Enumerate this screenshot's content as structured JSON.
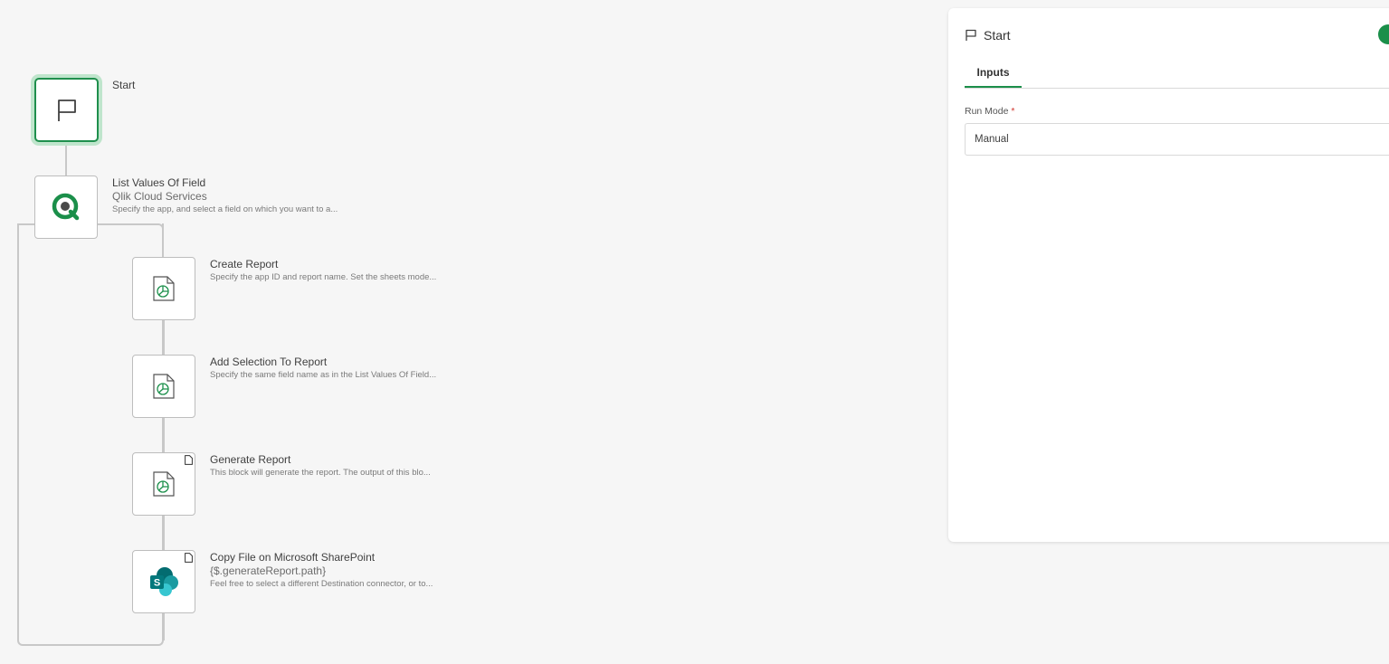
{
  "flow": {
    "start": {
      "label": "Start"
    },
    "list_values": {
      "title": "List Values Of Field",
      "subtitle": "Qlik Cloud Services",
      "description": "Specify the app, and select a field on which you want to a..."
    },
    "create_report": {
      "title": "Create Report",
      "description": "Specify the app ID  and report name. Set the sheets mode..."
    },
    "add_selection": {
      "title": "Add Selection To Report",
      "description": "Specify the same field name as in the List Values Of Field..."
    },
    "generate_report": {
      "title": "Generate Report",
      "description": "This block will generate the report. The output of this blo..."
    },
    "copy_file": {
      "title": "Copy File on Microsoft SharePoint",
      "subtitle": "{$.generateReport.path}",
      "description": "Feel free to select a different Destination connector, or to..."
    }
  },
  "panel": {
    "title": "Start",
    "tab_inputs": "Inputs",
    "run_mode_label": "Run Mode",
    "required_mark": "*",
    "run_mode_value": "Manual"
  },
  "colors": {
    "accent": "#1b8f4a",
    "start_glow": "#bfe5cc",
    "connector": "#c8c8c8"
  },
  "icons": {
    "start": "flag-icon",
    "qlik": "qlik-logo-icon",
    "report": "report-document-icon",
    "sharepoint": "sharepoint-logo-icon",
    "badge": "file-badge-icon"
  }
}
